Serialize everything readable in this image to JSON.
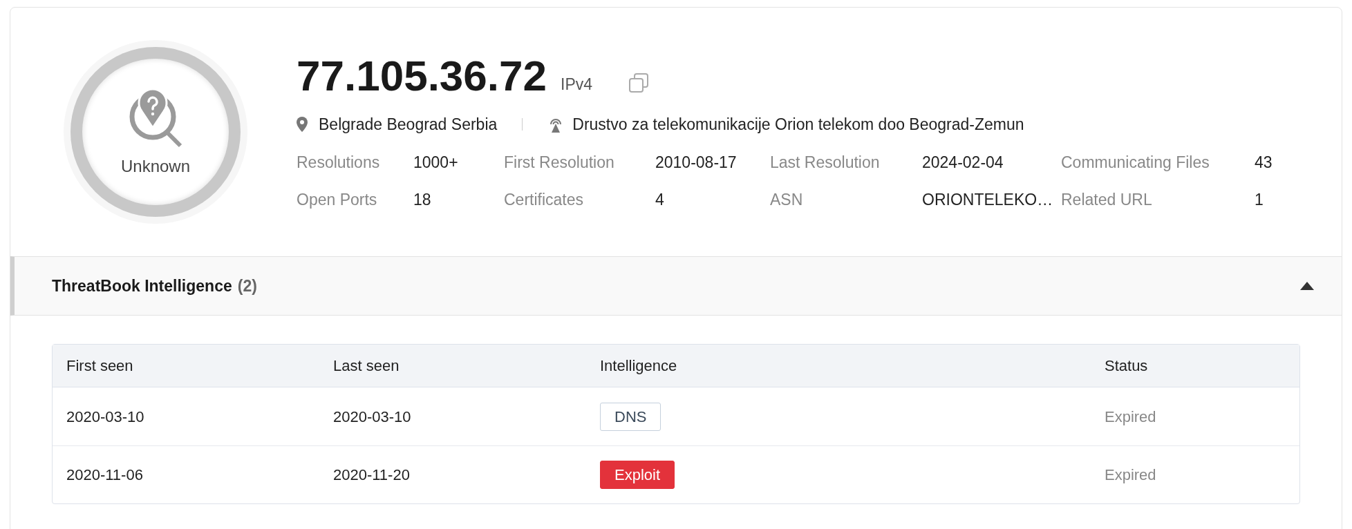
{
  "verdict": {
    "label": "Unknown"
  },
  "header": {
    "ip": "77.105.36.72",
    "ip_type": "IPv4",
    "location": "Belgrade Beograd Serbia",
    "isp": "Drustvo za telekomunikacije Orion telekom doo Beograd-Zemun"
  },
  "stats": [
    {
      "label": "Resolutions",
      "value": "1000+"
    },
    {
      "label": "First Resolution",
      "value": "2010-08-17"
    },
    {
      "label": "Last Resolution",
      "value": "2024-02-04"
    },
    {
      "label": "Communicating Files",
      "value": "43"
    },
    {
      "label": "Open Ports",
      "value": "18"
    },
    {
      "label": "Certificates",
      "value": "4"
    },
    {
      "label": "ASN",
      "value": "ORIONTELEKO…"
    },
    {
      "label": "Related URL",
      "value": "1"
    }
  ],
  "section": {
    "title": "ThreatBook Intelligence",
    "count": "(2)",
    "expanded": true
  },
  "table": {
    "columns": [
      "First seen",
      "Last seen",
      "Intelligence",
      "Status"
    ],
    "rows": [
      {
        "first_seen": "2020-03-10",
        "last_seen": "2020-03-10",
        "tag": {
          "label": "DNS",
          "kind": "outline"
        },
        "status": "Expired"
      },
      {
        "first_seen": "2020-11-06",
        "last_seen": "2020-11-20",
        "tag": {
          "label": "Exploit",
          "kind": "danger"
        },
        "status": "Expired"
      }
    ]
  }
}
